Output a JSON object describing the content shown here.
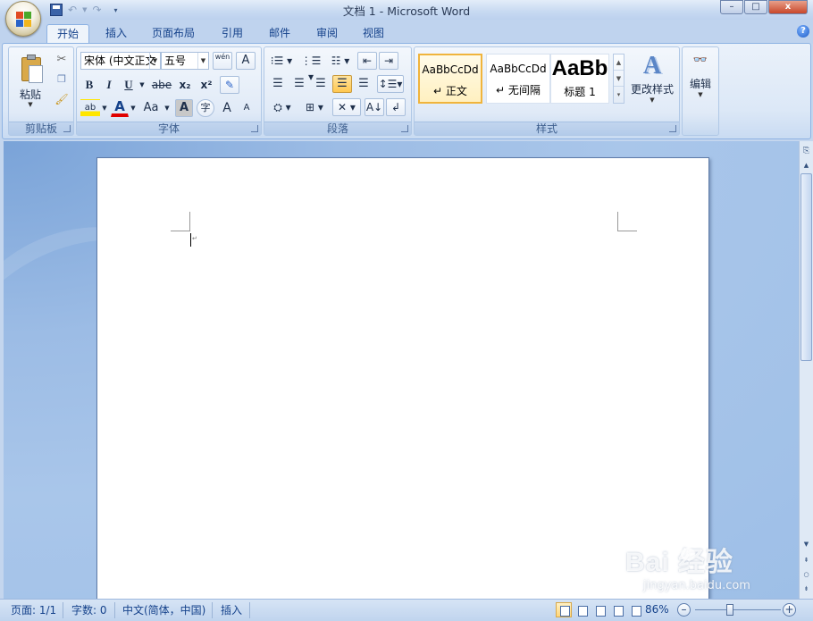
{
  "window": {
    "title": "文档 1 - Microsoft Word",
    "buttons": {
      "minimize": "–",
      "maximize": "□",
      "close": "x"
    }
  },
  "tabs": [
    {
      "label": "开始",
      "active": true
    },
    {
      "label": "插入"
    },
    {
      "label": "页面布局"
    },
    {
      "label": "引用"
    },
    {
      "label": "邮件"
    },
    {
      "label": "审阅"
    },
    {
      "label": "视图"
    }
  ],
  "clipboard": {
    "label": "剪贴板",
    "paste_label": "粘贴"
  },
  "font": {
    "label": "字体",
    "font_name": "宋体 (中文正文",
    "font_size": "五号",
    "buttons": {
      "bold": "B",
      "italic": "I",
      "underline": "U",
      "strike": "abe",
      "subscript": "x₂",
      "superscript": "x²",
      "font_color": "A",
      "change_case": "Aa",
      "grow": "A",
      "shrink": "A",
      "phonetic": "wén",
      "char_border": "A",
      "char_shading": "A",
      "enclose": "字"
    }
  },
  "paragraph": {
    "label": "段落"
  },
  "styles": {
    "label": "样式",
    "items": [
      {
        "sample": "AaBbCcDd",
        "name": "正文",
        "selected": true
      },
      {
        "sample": "AaBbCcDd",
        "name": "无间隔"
      },
      {
        "sample": "AaBb",
        "name": "标题 1"
      }
    ],
    "change_styles": "更改样式"
  },
  "editing": {
    "label": "编辑"
  },
  "status": {
    "page": "页面: 1/1",
    "words": "字数: 0",
    "language": "中文(简体，中国)",
    "mode": "插入",
    "zoom": "86%",
    "zoom_minus": "–",
    "zoom_plus": "+"
  },
  "watermark": {
    "main": "Bai 经验",
    "sub": "jingyan.baidu.com"
  },
  "colors": {
    "accent": "#15428b",
    "office_red": "#e04a22",
    "office_green": "#4aa82a",
    "office_blue": "#2a63c8",
    "office_yellow": "#f2b51c"
  }
}
